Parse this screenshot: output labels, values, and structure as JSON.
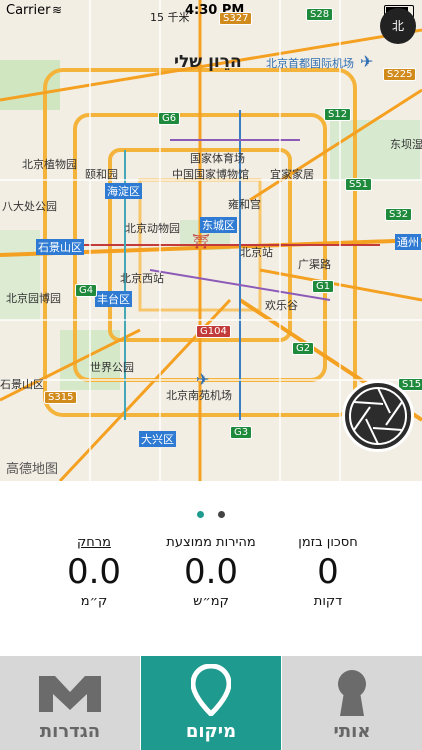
{
  "status_bar": {
    "carrier": "Carrier",
    "time": "4:30 PM"
  },
  "map": {
    "title": "הרֵון שלי",
    "scale": "15 千米",
    "labels": [
      "北京首都国际机场",
      "北京植物园",
      "颐和园",
      "中国国家博物馆",
      "宜家家居",
      "国家体育场",
      "海淀区",
      "东城区",
      "北京动物园",
      "北京站",
      "八大处公园",
      "石景山区",
      "北京西站",
      "丰台区",
      "北京园博园",
      "欢乐谷",
      "世界公园",
      "北京南苑机场",
      "大兴区",
      "广渠路",
      "东坝湿地公园",
      "通州",
      "石景山区",
      "雍和宫"
    ],
    "shields": [
      "S28",
      "S327",
      "S225",
      "G6",
      "S12",
      "S51",
      "S32",
      "G4",
      "G1",
      "G104",
      "G2",
      "S15",
      "S315",
      "G3"
    ],
    "watermark": "高德地图",
    "compass": "北"
  },
  "pager": {
    "count": 2,
    "active": 0
  },
  "stats": [
    {
      "label": "חסכון בזמן",
      "value": "0",
      "unit": "דקות"
    },
    {
      "label": "מהירות ממוצעת",
      "value": "0.0",
      "unit": "קמ״ש"
    },
    {
      "label": "מרחק",
      "value": "0.0",
      "unit": "ק״מ"
    }
  ],
  "tabs": [
    {
      "label": "הגדרות",
      "icon": "settings-m-icon",
      "active": false
    },
    {
      "label": "מיקום",
      "icon": "location-pin-icon",
      "active": true
    },
    {
      "label": "אותי",
      "icon": "keyhole-icon",
      "active": false
    }
  ],
  "colors": {
    "accent": "#1f9a8e",
    "tab_inactive": "#d7d7d7"
  }
}
